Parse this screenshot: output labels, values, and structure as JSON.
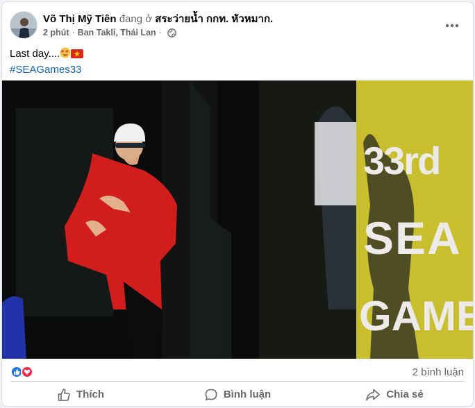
{
  "post": {
    "author": "Võ Thị Mỹ Tiên",
    "action": "đang ở",
    "place": "สระว่ายน้ำ กกท. หัวหมาก.",
    "time": "2 phút",
    "location": "Ban Takli, Thái Lan",
    "caption": "Last day....",
    "hashtag": "#SEAGames33",
    "photo": {
      "banner_text": [
        "33rd",
        "SEA",
        "GAMES"
      ],
      "banner_color": "#c9bf2e"
    }
  },
  "stats": {
    "reactions": [
      "like-icon",
      "love-icon"
    ],
    "comments": "2 bình luận"
  },
  "actions": {
    "like": "Thích",
    "comment": "Bình luận",
    "share": "Chia sẻ"
  },
  "colors": {
    "link": "#0a66c2",
    "secondary_text": "#65676b",
    "like_blue": "#1b74e4",
    "love_red": "#f02849"
  }
}
